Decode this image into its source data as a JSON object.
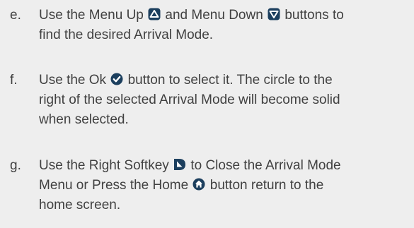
{
  "steps": [
    {
      "letter": "e.",
      "lines": [
        {
          "parts": [
            {
              "text": "Use the Menu Up "
            },
            {
              "icon": "menu-up-icon"
            },
            {
              "text": " and Menu Down "
            },
            {
              "icon": "menu-down-icon"
            },
            {
              "text": " buttons to"
            }
          ]
        },
        {
          "parts": [
            {
              "text": "find the desired Arrival Mode."
            }
          ]
        }
      ]
    },
    {
      "letter": "f.",
      "lines": [
        {
          "parts": [
            {
              "text": "Use the Ok "
            },
            {
              "icon": "ok-icon"
            },
            {
              "text": " button to select it. The circle to the"
            }
          ]
        },
        {
          "parts": [
            {
              "text": "right of the selected Arrival Mode will become solid"
            }
          ]
        },
        {
          "parts": [
            {
              "text": "when selected."
            }
          ]
        }
      ]
    },
    {
      "letter": "g.",
      "lines": [
        {
          "parts": [
            {
              "text": "Use the Right Softkey "
            },
            {
              "icon": "right-softkey-icon"
            },
            {
              "text": " to Close the Arrival Mode"
            }
          ]
        },
        {
          "parts": [
            {
              "text": "Menu or Press the Home "
            },
            {
              "icon": "home-icon"
            },
            {
              "text": " button return to the"
            }
          ]
        },
        {
          "parts": [
            {
              "text": "home screen."
            }
          ]
        }
      ]
    }
  ],
  "colors": {
    "background": "#eeeeee",
    "text": "#414141",
    "icon_fill": "#1c3f5e",
    "icon_glyph": "#ffffff"
  }
}
